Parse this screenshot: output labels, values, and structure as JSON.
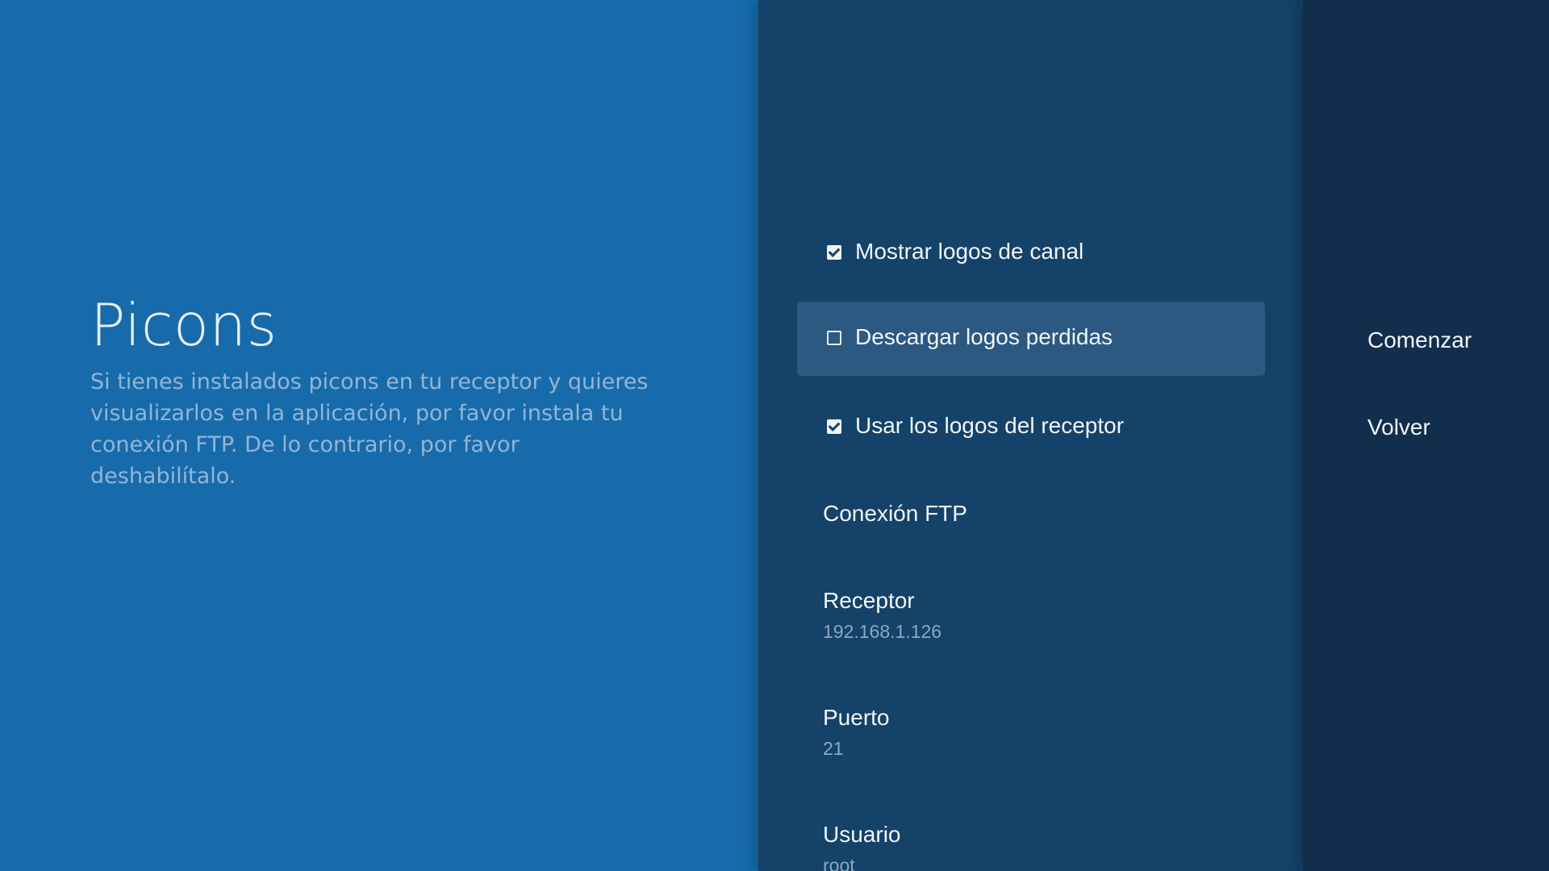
{
  "guidance": {
    "title": "Picons",
    "description": "Si tienes instalados picons en tu receptor y quieres visualizarlos en la aplicación, por favor instala tu conexión FTP. De lo contrario, por favor deshabilítalo."
  },
  "actions": [
    {
      "label": "Mostrar logos de canal",
      "checked": true
    },
    {
      "label": "Descargar logos perdidas",
      "checked": false,
      "focused": true
    },
    {
      "label": "Usar los logos del receptor",
      "checked": true
    }
  ],
  "ftp": {
    "header": "Conexión FTP",
    "receptor": {
      "label": "Receptor",
      "value": "192.168.1.126"
    },
    "puerto": {
      "label": "Puerto",
      "value": "21"
    },
    "usuario": {
      "label": "Usuario",
      "value": "root"
    }
  },
  "buttons": {
    "start": "Comenzar",
    "back": "Volver"
  }
}
